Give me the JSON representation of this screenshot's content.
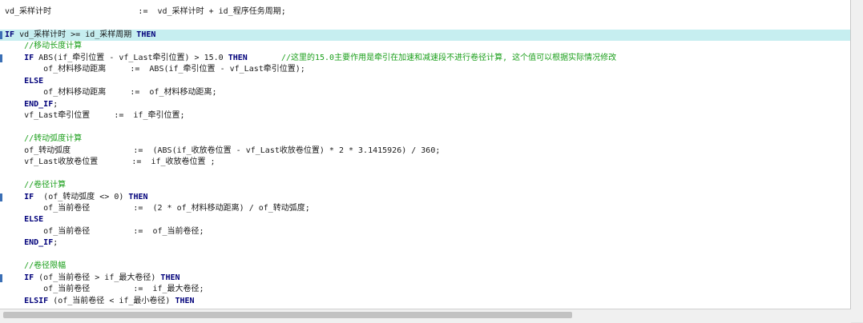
{
  "editor": {
    "lines": [
      [
        {
          "t": "vd_采样计时                  :=  vd_采样计时 + id_程序任务周期;",
          "c": "t"
        }
      ],
      [],
      [
        {
          "t": "IF",
          "c": "kw"
        },
        {
          "t": " vd_采样计时 >= id_采样周期 ",
          "c": "t"
        },
        {
          "t": "THEN",
          "c": "kw"
        }
      ],
      [
        {
          "t": "    //移动长度计算",
          "c": "cm"
        }
      ],
      [
        {
          "t": "    ",
          "c": "t"
        },
        {
          "t": "IF",
          "c": "kw"
        },
        {
          "t": " ABS(if_牵引位置 - vf_Last牵引位置) > 15.0 ",
          "c": "t"
        },
        {
          "t": "THEN",
          "c": "kw"
        },
        {
          "t": "       //这里的15.0主要作用是牵引在加速和减速段不进行卷径计算, 这个值可以根据实际情况修改",
          "c": "cm"
        }
      ],
      [
        {
          "t": "        of_材料移动距离     :=  ABS(if_牵引位置 - vf_Last牵引位置);",
          "c": "t"
        }
      ],
      [
        {
          "t": "    ",
          "c": "t"
        },
        {
          "t": "ELSE",
          "c": "kw"
        }
      ],
      [
        {
          "t": "        of_材料移动距离     :=  of_材料移动距离;",
          "c": "t"
        }
      ],
      [
        {
          "t": "    ",
          "c": "t"
        },
        {
          "t": "END_IF",
          "c": "kw"
        },
        {
          "t": ";",
          "c": "t"
        }
      ],
      [
        {
          "t": "    vf_Last牵引位置     :=  if_牵引位置;",
          "c": "t"
        }
      ],
      [],
      [
        {
          "t": "    //转动弧度计算",
          "c": "cm"
        }
      ],
      [
        {
          "t": "    of_转动弧度             :=  (ABS(if_收放卷位置 - vf_Last收放卷位置) * 2 * 3.1415926) / 360;",
          "c": "t"
        }
      ],
      [
        {
          "t": "    vf_Last收放卷位置       :=  if_收放卷位置 ;",
          "c": "t"
        }
      ],
      [],
      [
        {
          "t": "    //卷径计算",
          "c": "cm"
        }
      ],
      [
        {
          "t": "    ",
          "c": "t"
        },
        {
          "t": "IF",
          "c": "kw"
        },
        {
          "t": "  (of_转动弧度 <> 0) ",
          "c": "t"
        },
        {
          "t": "THEN",
          "c": "kw"
        }
      ],
      [
        {
          "t": "        of_当前卷径         :=  (2 * of_材料移动距离) / of_转动弧度;",
          "c": "t"
        }
      ],
      [
        {
          "t": "    ",
          "c": "t"
        },
        {
          "t": "ELSE",
          "c": "kw"
        }
      ],
      [
        {
          "t": "        of_当前卷径         :=  of_当前卷径;",
          "c": "t"
        }
      ],
      [
        {
          "t": "    ",
          "c": "t"
        },
        {
          "t": "END_IF",
          "c": "kw"
        },
        {
          "t": ";",
          "c": "t"
        }
      ],
      [],
      [
        {
          "t": "    //卷径限幅",
          "c": "cm"
        }
      ],
      [
        {
          "t": "    ",
          "c": "t"
        },
        {
          "t": "IF",
          "c": "kw"
        },
        {
          "t": " (of_当前卷径 > if_最大卷径) ",
          "c": "t"
        },
        {
          "t": "THEN",
          "c": "kw"
        }
      ],
      [
        {
          "t": "        of_当前卷径         :=  if_最大卷径;",
          "c": "t"
        }
      ],
      [
        {
          "t": "    ",
          "c": "t"
        },
        {
          "t": "ELSIF",
          "c": "kw"
        },
        {
          "t": " (of_当前卷径 < if_最小卷径) ",
          "c": "t"
        },
        {
          "t": "THEN",
          "c": "kw"
        }
      ]
    ],
    "highlight_line": 2,
    "colors": {
      "keyword": "#00007a",
      "comment": "#1b9f1b",
      "highlight": "#c6eef0"
    }
  }
}
